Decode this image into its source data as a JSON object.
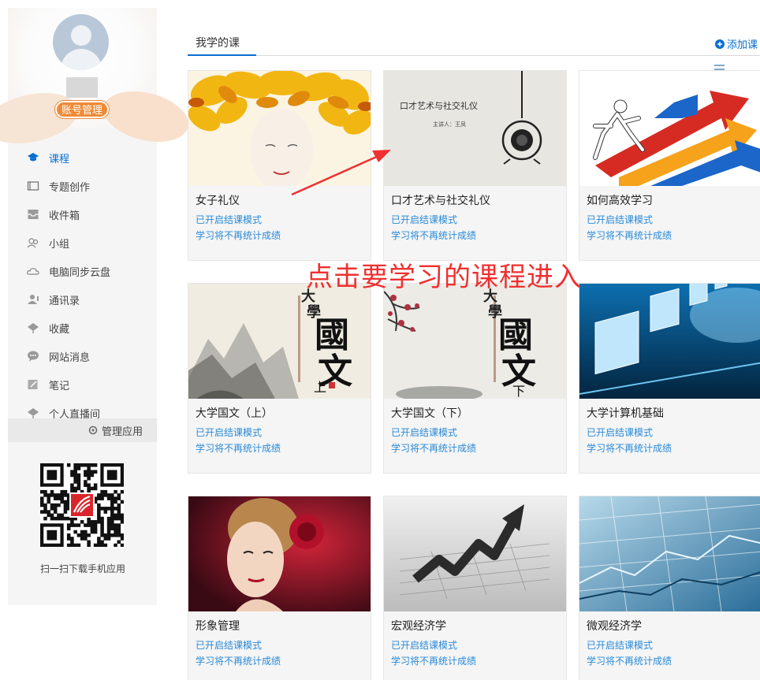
{
  "sidebar": {
    "account_button": "账号管理",
    "items": [
      {
        "label": "课程",
        "icon": "course-icon",
        "active": true
      },
      {
        "label": "专题创作",
        "icon": "topic-icon",
        "active": false
      },
      {
        "label": "收件箱",
        "icon": "inbox-icon",
        "active": false
      },
      {
        "label": "小组",
        "icon": "group-icon",
        "active": false
      },
      {
        "label": "电脑同步云盘",
        "icon": "cloud-icon",
        "active": false
      },
      {
        "label": "通讯录",
        "icon": "contacts-icon",
        "active": false
      },
      {
        "label": "收藏",
        "icon": "favorite-icon",
        "active": false
      },
      {
        "label": "网站消息",
        "icon": "message-icon",
        "active": false
      },
      {
        "label": "笔记",
        "icon": "note-icon",
        "active": false
      },
      {
        "label": "个人直播间",
        "icon": "live-icon",
        "active": false
      }
    ],
    "manage_apps": "管理应用",
    "qr_caption": "扫一扫下载手机应用"
  },
  "main": {
    "tab": "我学的课",
    "add_course": "添加课",
    "annotation": "点击要学习的课程进入",
    "courses": [
      {
        "title": "女子礼仪",
        "status": "已开启结课模式",
        "note": "学习将不再统计成绩"
      },
      {
        "title": "口才艺术与社交礼仪",
        "status": "已开启结课模式",
        "note": "学习将不再统计成绩",
        "cover_text": "口才艺术与社交礼仪",
        "cover_sub": "主讲人：王凤"
      },
      {
        "title": "如何高效学习",
        "status": "已开启结课模式",
        "note": "学习将不再统计成绩"
      },
      {
        "title": "大学国文（上）",
        "status": "已开启结课模式",
        "note": "学习将不再统计成绩",
        "cover_a": "大",
        "cover_b": "學",
        "cover_c": "國",
        "cover_d": "文",
        "cover_e": "上"
      },
      {
        "title": "大学国文（下）",
        "status": "已开启结课模式",
        "note": "学习将不再统计成绩",
        "cover_a": "大",
        "cover_b": "學",
        "cover_c": "國",
        "cover_d": "文",
        "cover_e": "下"
      },
      {
        "title": "大学计算机基础",
        "status": "已开启结课模式",
        "note": "学习将不再统计成绩"
      },
      {
        "title": "形象管理",
        "status": "已开启结课模式",
        "note": "学习将不再统计成绩"
      },
      {
        "title": "宏观经济学",
        "status": "已开启结课模式",
        "note": "学习将不再统计成绩"
      },
      {
        "title": "微观经济学",
        "status": "已开启结课模式",
        "note": "学习将不再统计成绩"
      }
    ]
  },
  "colors": {
    "accent": "#0a6fd1",
    "link": "#2a8ad7",
    "annotation": "#f03030",
    "account": "#f08a36"
  }
}
